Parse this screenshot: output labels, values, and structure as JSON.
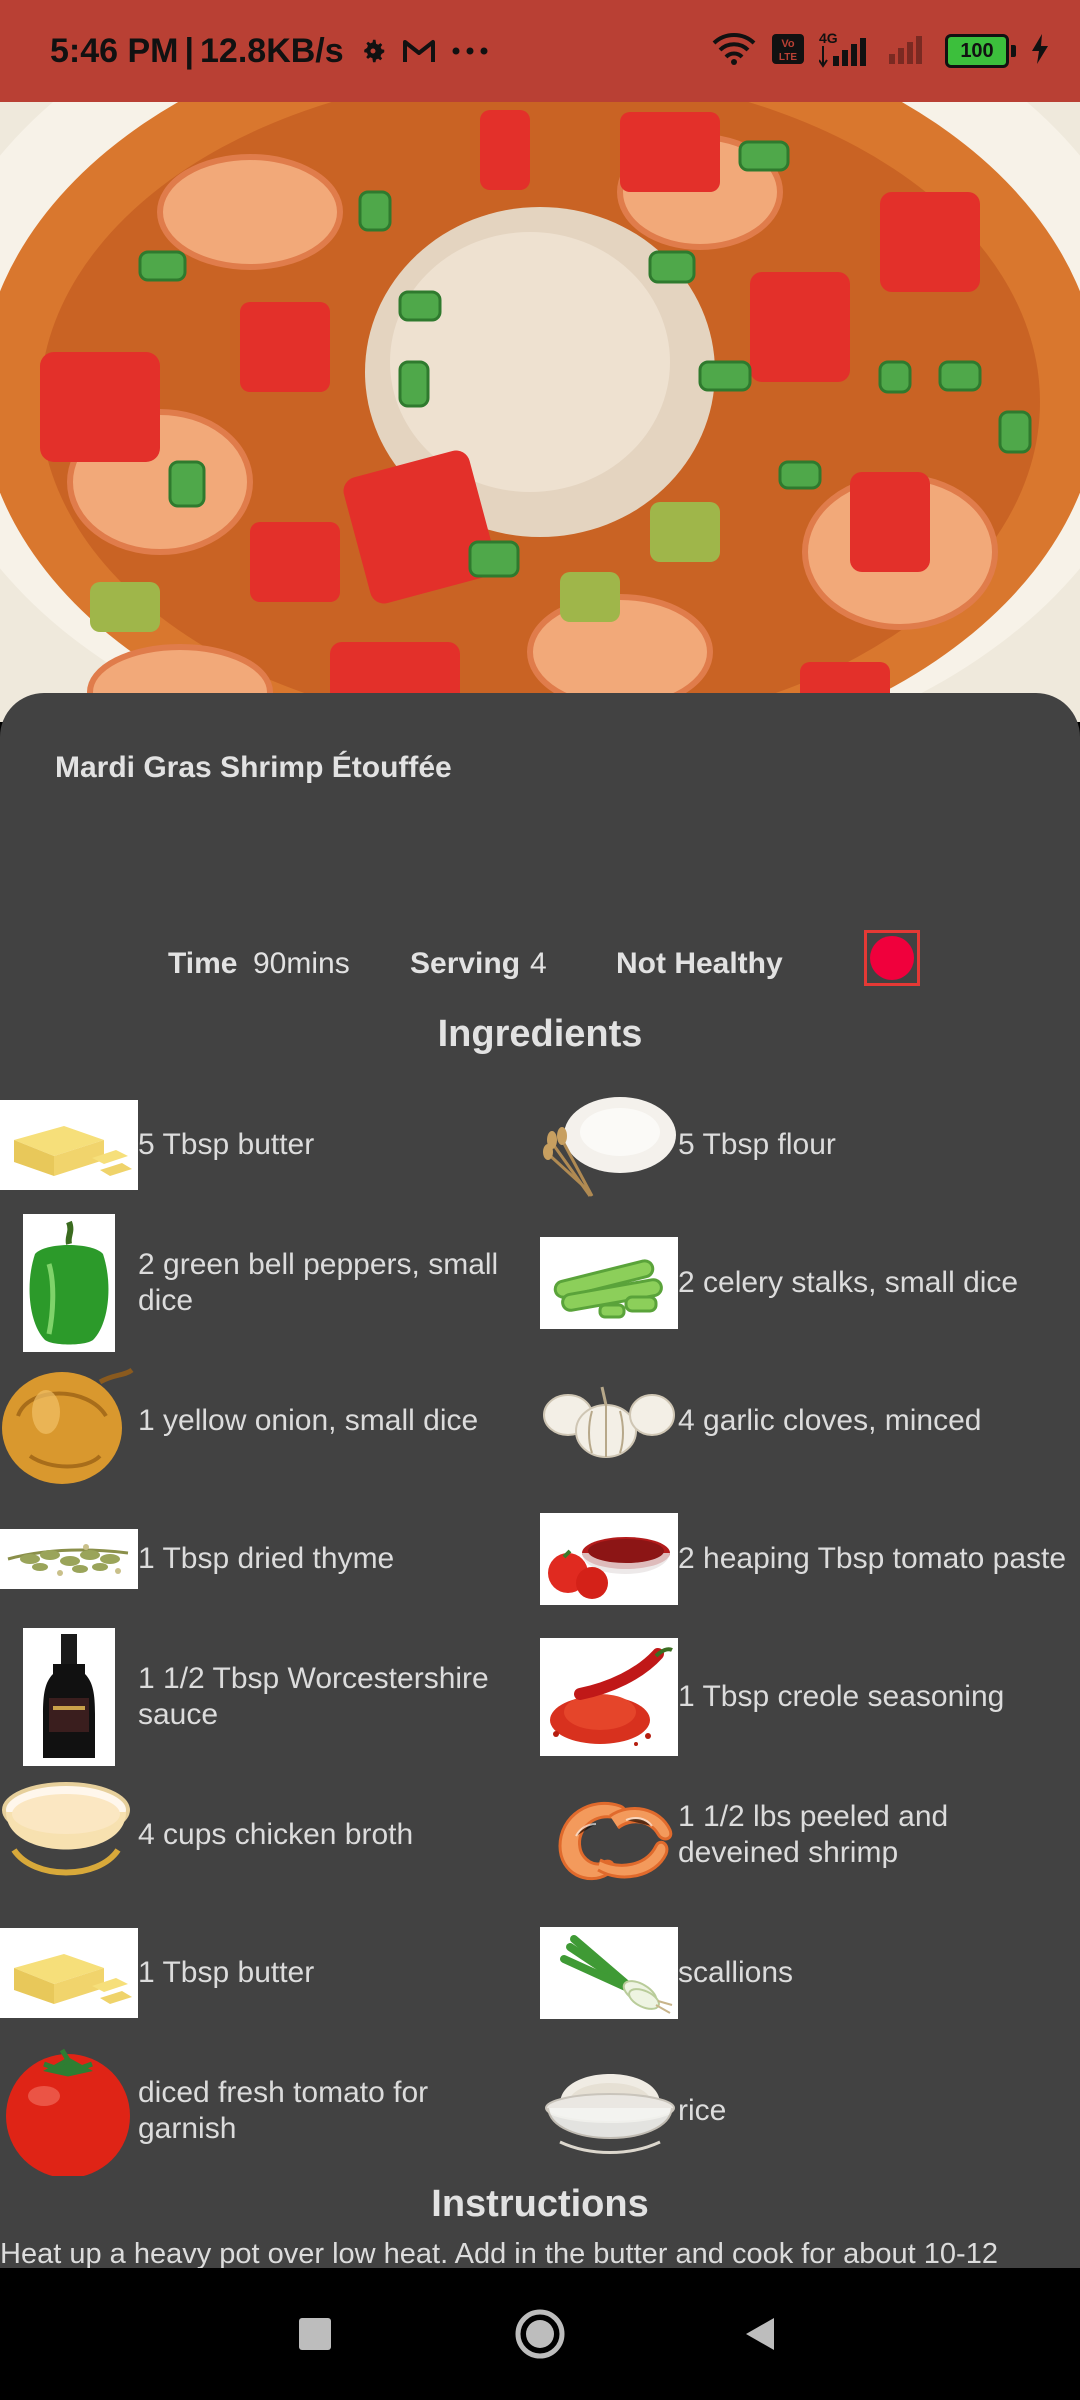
{
  "status_bar": {
    "time": "5:46 PM",
    "network_speed": "12.8KB/s",
    "network_type": "4G",
    "battery_level": "100",
    "icons": [
      "gear-icon",
      "gmail-icon",
      "more-icon",
      "wifi-icon",
      "volte-icon",
      "signal-icon",
      "signal-weak-icon",
      "battery-icon",
      "charging-icon"
    ]
  },
  "recipe": {
    "title": "Mardi Gras Shrimp Étouffée",
    "time_label": "Time",
    "time_value": "90mins",
    "serving_label": "Serving",
    "serving_value": "4",
    "health_label": "Not Healthy",
    "record_color": "#f0003c"
  },
  "ingredients_title": "Ingredients",
  "ingredients": [
    {
      "text": "5 Tbsp butter",
      "image": "butter"
    },
    {
      "text": "5 Tbsp flour",
      "image": "flour"
    },
    {
      "text": "2 green bell peppers, small dice",
      "image": "green-pepper"
    },
    {
      "text": "2 celery stalks, small dice",
      "image": "celery"
    },
    {
      "text": "1 yellow onion, small dice",
      "image": "onion"
    },
    {
      "text": "4 garlic cloves, minced",
      "image": "garlic"
    },
    {
      "text": "1 Tbsp dried thyme",
      "image": "thyme"
    },
    {
      "text": "2 heaping Tbsp tomato paste",
      "image": "tomato-paste"
    },
    {
      "text": "1 1/2 Tbsp Worcestershire sauce",
      "image": "worcestershire"
    },
    {
      "text": "1 Tbsp creole seasoning",
      "image": "creole-seasoning"
    },
    {
      "text": "4 cups chicken broth",
      "image": "chicken-broth"
    },
    {
      "text": "1 1/2 lbs peeled and deveined shrimp",
      "image": "shrimp"
    },
    {
      "text": "1 Tbsp butter",
      "image": "butter"
    },
    {
      "text": "scallions",
      "image": "scallions"
    },
    {
      "text": "diced fresh tomato for garnish",
      "image": "tomato"
    },
    {
      "text": "rice",
      "image": "rice"
    }
  ],
  "instructions_title": "Instructions",
  "instructions_text": "Heat up a heavy pot over low heat. Add in the butter and cook for about 10-12",
  "nav": {
    "recents": "recents-icon",
    "home": "home-icon",
    "back": "back-icon"
  }
}
